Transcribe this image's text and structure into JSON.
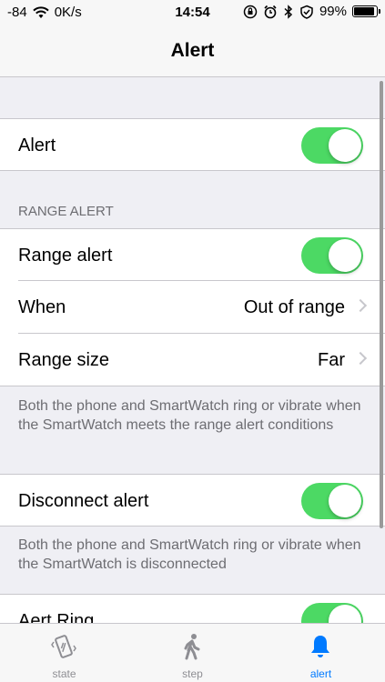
{
  "status_bar": {
    "signal": "-84",
    "speed": "0K/s",
    "time": "14:54",
    "battery": "99%"
  },
  "nav": {
    "title": "Alert"
  },
  "rows": {
    "alert": {
      "label": "Alert",
      "on": true
    },
    "range_alert": {
      "label": "Range alert",
      "on": true
    },
    "when": {
      "label": "When",
      "value": "Out of range"
    },
    "range_size": {
      "label": "Range size",
      "value": "Far"
    },
    "disconnect": {
      "label": "Disconnect alert",
      "on": true
    },
    "alert_ring": {
      "label": "Aert Ring",
      "on": true
    }
  },
  "sections": {
    "range_header": "RANGE ALERT",
    "range_footer": "Both the phone and SmartWatch ring or vibrate when the SmartWatch meets the range alert conditions",
    "disconnect_footer": "Both the phone and SmartWatch ring or vibrate when the SmartWatch is disconnected"
  },
  "tabs": [
    {
      "label": "state",
      "icon": "phone-vibrate-icon",
      "active": false
    },
    {
      "label": "step",
      "icon": "walking-icon",
      "active": false
    },
    {
      "label": "alert",
      "icon": "bell-icon",
      "active": true
    }
  ],
  "colors": {
    "accent": "#007aff",
    "toggle_on": "#4cd964",
    "background": "#efeff4"
  }
}
